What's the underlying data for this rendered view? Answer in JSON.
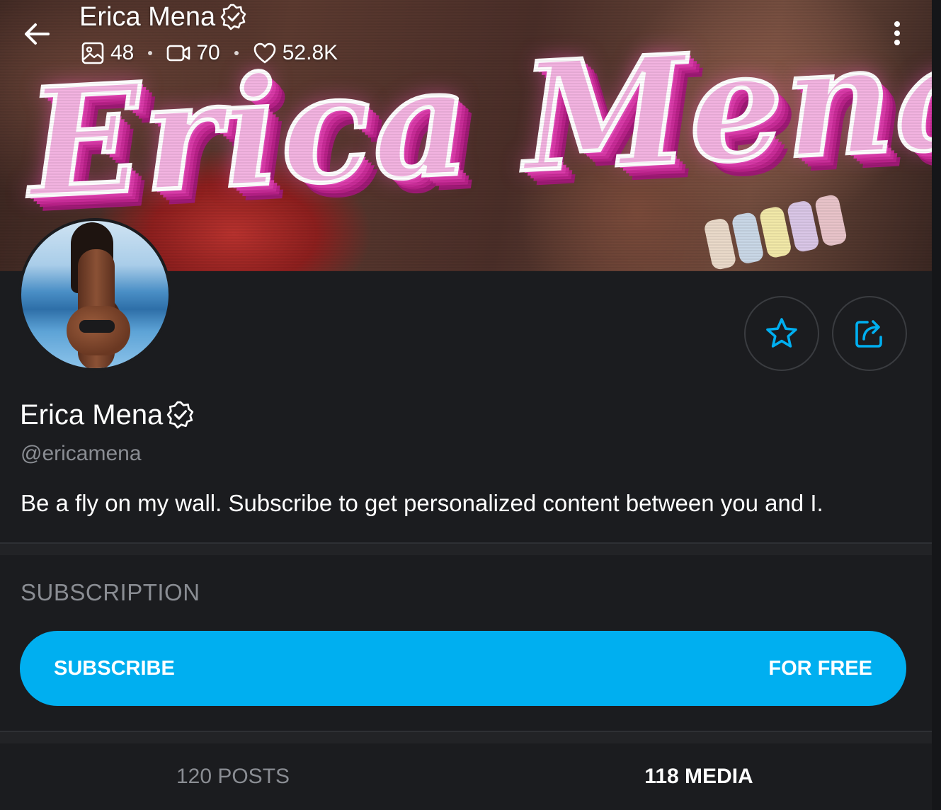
{
  "header": {
    "name": "Erica Mena",
    "stats": {
      "photos": "48",
      "videos": "70",
      "likes": "52.8K"
    }
  },
  "cover": {
    "art_text": "Erica Mena"
  },
  "profile": {
    "name": "Erica Mena",
    "handle": "@ericamena",
    "bio": "Be a fly on my wall. Subscribe to get personalized content between you and I.",
    "verified": true
  },
  "subscription": {
    "heading": "SUBSCRIPTION",
    "button_label": "SUBSCRIBE",
    "price_label": "FOR FREE"
  },
  "tabs": [
    {
      "label": "120 POSTS",
      "active": false
    },
    {
      "label": "118 MEDIA",
      "active": true
    }
  ],
  "colors": {
    "accent": "#00aff0",
    "background": "#1b1c1f",
    "muted_text": "#8a8d93"
  },
  "icons": {
    "back": "arrow-left-icon",
    "verified": "verified-badge-icon",
    "photos": "image-icon",
    "videos": "video-camera-icon",
    "likes": "heart-icon",
    "more": "more-vertical-icon",
    "favorite": "star-icon",
    "share": "share-icon"
  }
}
